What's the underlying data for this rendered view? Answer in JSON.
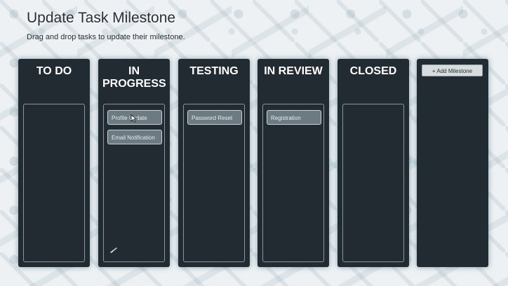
{
  "header": {
    "title": "Update Task Milestone",
    "subtitle": "Drag and drop tasks to update their milestone."
  },
  "columns": [
    {
      "title": "TO DO",
      "tasks": []
    },
    {
      "title": "IN PROGRESS",
      "tasks": [
        "Profile Update",
        "Email Notification"
      ]
    },
    {
      "title": "TESTING",
      "tasks": [
        "Password Reset"
      ]
    },
    {
      "title": "IN REVIEW",
      "tasks": [
        "Registration"
      ]
    },
    {
      "title": "CLOSED",
      "tasks": []
    }
  ],
  "add_milestone_label": "+ Add Milestone",
  "colors": {
    "column_bg": "#222a32",
    "card_bg": "#6c7a82",
    "page_bg": "#eef1f3"
  }
}
